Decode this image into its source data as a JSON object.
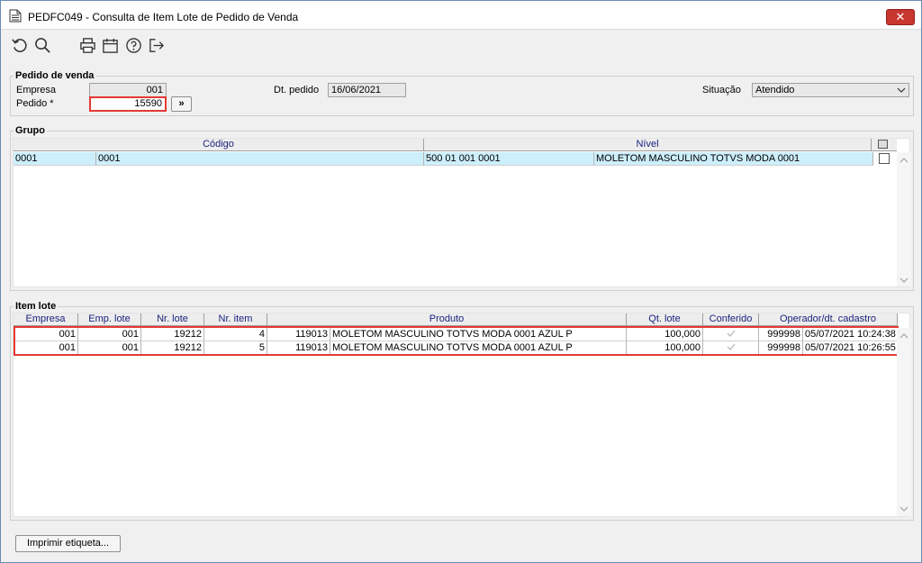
{
  "window": {
    "title": "PEDFC049 - Consulta de Item Lote de Pedido de Venda",
    "close_label": "✕"
  },
  "toolbar": {
    "icons": [
      "refresh-icon",
      "search-icon",
      "print-icon",
      "calendar-icon",
      "help-icon",
      "exit-icon"
    ]
  },
  "pedido": {
    "legend": "Pedido de venda",
    "empresa_label": "Empresa",
    "empresa_value": "001",
    "pedido_label": "Pedido *",
    "pedido_value": "15590",
    "search_button": "»",
    "dt_pedido_label": "Dt. pedido",
    "dt_pedido_value": "16/06/2021",
    "situacao_label": "Situação",
    "situacao_value": "Atendido"
  },
  "grupo": {
    "legend": "Grupo",
    "headers": [
      "Código",
      "Nível"
    ],
    "rows": [
      {
        "codigo_a": "0001",
        "codigo_b": "0001",
        "nivel_code": "500 01 001 0001",
        "nivel_desc": "MOLETOM MASCULINO TOTVS MODA 0001",
        "checked": false
      }
    ]
  },
  "itemlote": {
    "legend": "Item lote",
    "headers": [
      "Empresa",
      "Emp. lote",
      "Nr. lote",
      "Nr. item",
      "Produto",
      "Qt. lote",
      "Conferido",
      "Operador/dt. cadastro"
    ],
    "rows": [
      {
        "empresa": "001",
        "emp_lote": "001",
        "nr_lote": "19212",
        "nr_item": "4",
        "prod_code": "119013",
        "prod_desc": "MOLETOM MASCULINO TOTVS MODA 0001 AZUL P",
        "qt_lote": "100,000",
        "conferido": true,
        "operador": "999998",
        "dt_cadastro": "05/07/2021 10:24:38"
      },
      {
        "empresa": "001",
        "emp_lote": "001",
        "nr_lote": "19212",
        "nr_item": "5",
        "prod_code": "119013",
        "prod_desc": "MOLETOM MASCULINO TOTVS MODA 0001 AZUL P",
        "qt_lote": "100,000",
        "conferido": true,
        "operador": "999998",
        "dt_cadastro": "05/07/2021 10:26:55"
      }
    ]
  },
  "footer": {
    "print_label_button": "Imprimir etiqueta..."
  },
  "colors": {
    "highlight": "#e53935",
    "selected_row": "#cdeefb",
    "header_text": "#1a237e"
  }
}
